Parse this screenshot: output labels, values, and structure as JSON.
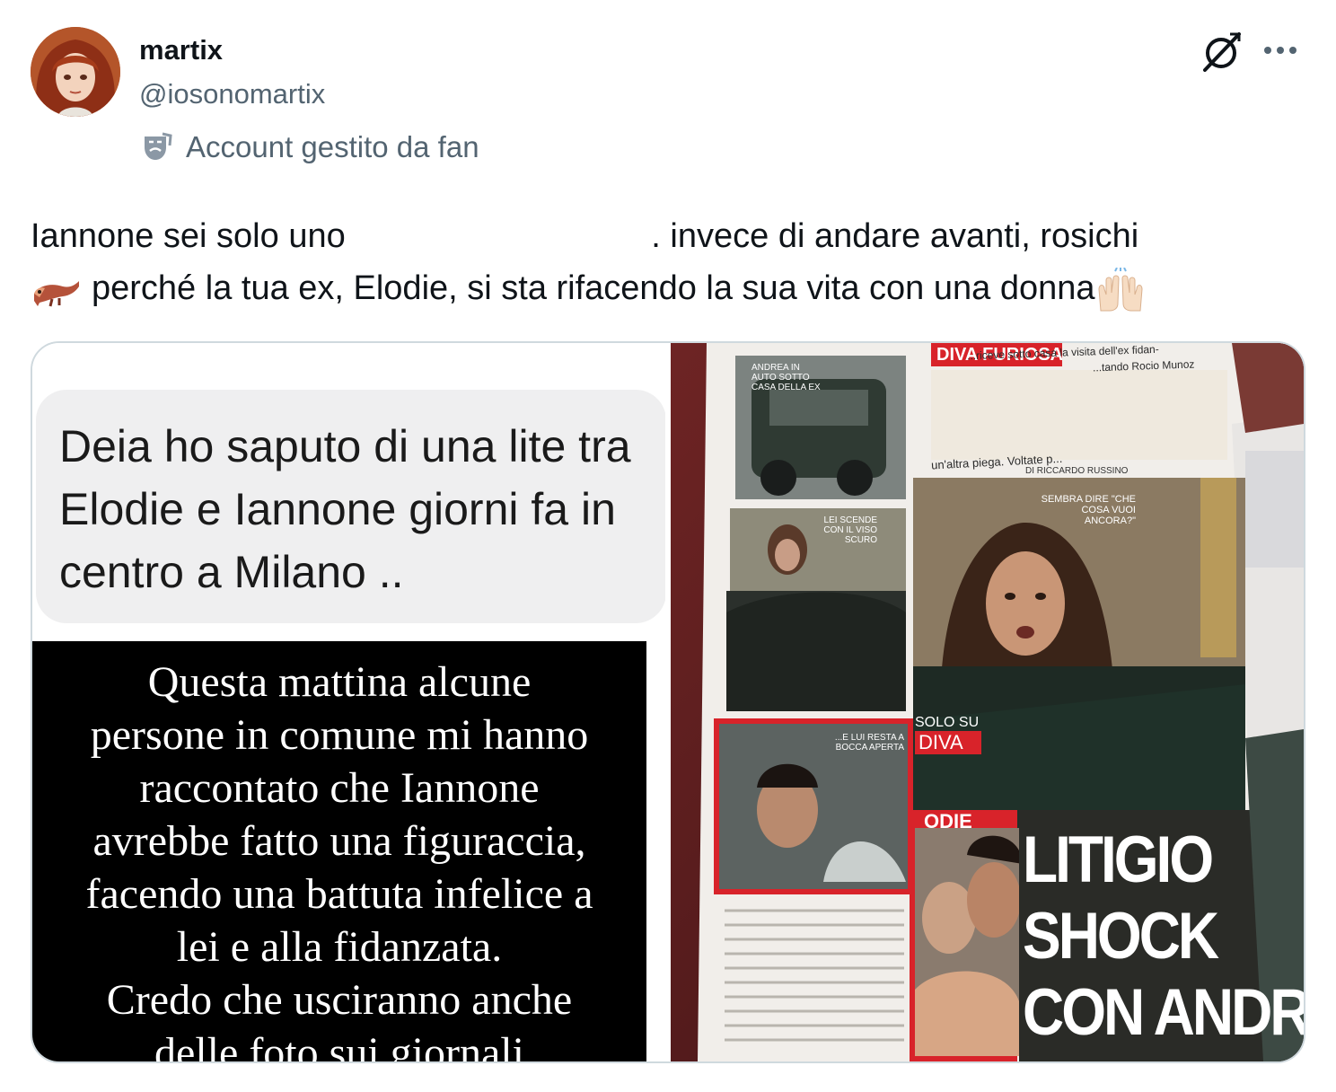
{
  "author": {
    "display_name": "martix",
    "handle": "@iosonomartix",
    "badge_label": "Account gestito da fan"
  },
  "post": {
    "line1_before": "Iannone sei solo uno",
    "line1_after": ". invece di andare avanti, rosichi",
    "line2": "perché la tua ex, Elodie, si sta rifacendo la sua vita con una donna"
  },
  "media": {
    "left": {
      "bubble_text": "Deia ho saputo di una lite tra Elodie e Iannone giorni fa in centro a Milano ..",
      "story_lines": [
        "Questa mattina alcune",
        "persone in comune mi hanno",
        "raccontato che Iannone",
        "avrebbe fatto una figuraccia,",
        "facendo una battuta infelice a",
        "lei e alla fidanzata.",
        "Credo che usciranno anche",
        "delle foto sui giornali"
      ]
    },
    "right": {
      "brand_tab": "DIVA FURIOSA",
      "deck_1": "...riceve sotto casa la visita dell'ex fidan-",
      "deck_2": "...tando Rocio Munoz",
      "deck_3": "un'altra piega. Voltate p...",
      "byline": "DI RICCARDO RUSSINO",
      "caption_car": "ANDREA IN AUTO SOTTO CASA DELLA EX",
      "caption_lei": "LEI SCENDE CON IL VISO SCURO",
      "caption_sembra": "SEMBRA DIRE \"CHE COSA VUOI ANCORA?\"",
      "caption_lui": "...E LUI RESTA A BOCCA APERTA",
      "solo_su": "SOLO SU",
      "diva": "DIVA",
      "elodie_tag": "ODIE",
      "headline": [
        "LITIGIO",
        "SHOCK",
        "CON ANDR"
      ]
    }
  },
  "icons": {
    "avatar": "avatar-image",
    "badge": "theater-mask-icon",
    "grok": "grok-icon",
    "more": "more-dots-icon",
    "ferret": "ferret-emoji",
    "hands": "raising-hands-emoji"
  },
  "colors": {
    "text_primary": "#0f1419",
    "text_secondary": "#536471",
    "border": "#cfd9de",
    "diva_red": "#d8232a"
  }
}
